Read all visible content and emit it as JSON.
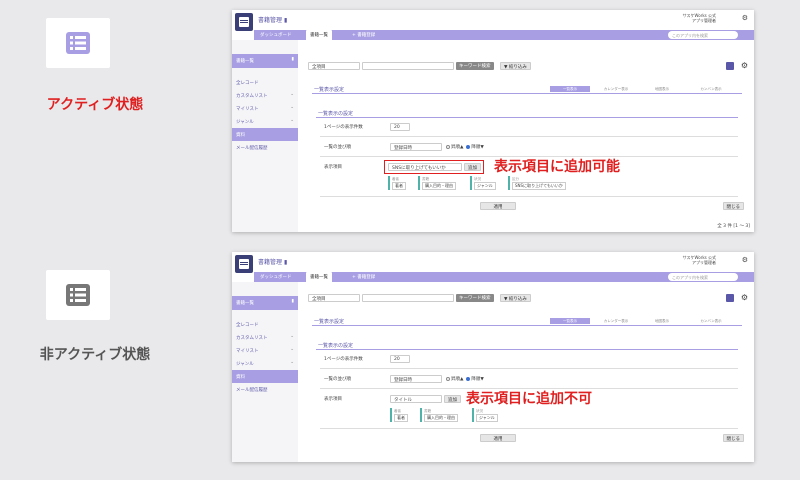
{
  "states": {
    "active": {
      "label": "アクティブ状態",
      "label_color": "#e02020",
      "icon": "list-icon",
      "icon_color": "#a79ee3",
      "annotation": "表示項目に追加可能"
    },
    "inactive": {
      "label": "非アクティブ状態",
      "label_color": "#555555",
      "icon": "list-icon",
      "icon_color": "#777777",
      "annotation": "表示項目に追加不可"
    }
  },
  "app": {
    "title": "書籍管理",
    "dashboard": "ダッシュボード",
    "list_tab": "書籍一覧",
    "register": "+ 書籍登録",
    "search_placeholder": "このアプリ内を検索",
    "user_line1": "サスケWorks 公式",
    "user_line2": "アプリ管理者",
    "accent": "#a79ee3"
  },
  "sidebar": {
    "header": "書籍一覧",
    "items": [
      "全レコード",
      "カスタムリスト",
      "マイリスト",
      "ジャンル",
      "資料",
      "メール配信履歴"
    ]
  },
  "toolbar": {
    "filter_value": "全項目",
    "keyword_button": "キーワード検索",
    "narrow_button": "▼ 絞り込み"
  },
  "settings": {
    "title": "一覧表示設定",
    "tabs": [
      "一覧表示",
      "カレンダー表示",
      "地図表示",
      "カンバン表示"
    ],
    "section": "一覧表示の設定",
    "per_page_label": "1ページの表示件数",
    "per_page_value": "20",
    "order_label": "一覧の並び順",
    "order_value": "登録日時",
    "asc": "昇順▲",
    "desc": "降順▼",
    "display_label": "表示項目",
    "add_button": "追加",
    "apply_button": "適用",
    "close_button": "閉じる",
    "pagination": "全 3 件 [1 ～ 3]"
  },
  "active_panel": {
    "display_select": "SNSに取り上げてもいいか",
    "chips": [
      {
        "cap": "著者",
        "val": "著者"
      },
      {
        "cap": "書籍",
        "val": "購入目的・理由"
      },
      {
        "cap": "状況",
        "val": "ジャンル"
      },
      {
        "cap": "区分",
        "val": "SNSに取り上げてもいいか"
      }
    ]
  },
  "inactive_panel": {
    "display_select": "タイトル",
    "chips": [
      {
        "cap": "著者",
        "val": "著者"
      },
      {
        "cap": "書籍",
        "val": "購入目的・理由"
      },
      {
        "cap": "状況",
        "val": "ジャンル"
      }
    ]
  }
}
